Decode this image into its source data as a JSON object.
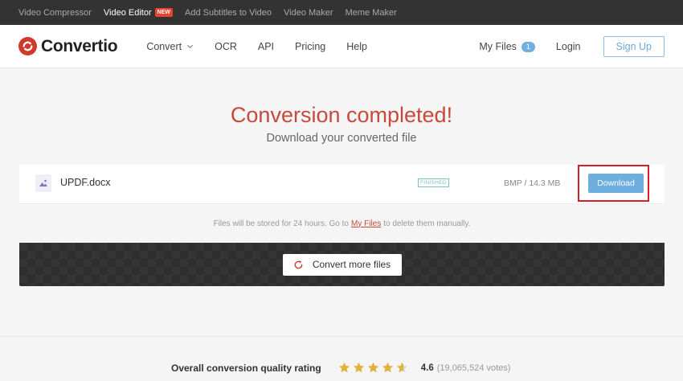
{
  "topbar": {
    "links": [
      {
        "label": "Video Compressor"
      },
      {
        "label": "Video Editor",
        "badge": "NEW"
      },
      {
        "label": "Add Subtitles to Video"
      },
      {
        "label": "Video Maker"
      },
      {
        "label": "Meme Maker"
      }
    ]
  },
  "header": {
    "logo_text": "Convertio",
    "nav": [
      {
        "label": "Convert"
      },
      {
        "label": "OCR"
      },
      {
        "label": "API"
      },
      {
        "label": "Pricing"
      },
      {
        "label": "Help"
      }
    ],
    "my_files_label": "My Files",
    "my_files_count": "1",
    "login_label": "Login",
    "signup_label": "Sign Up"
  },
  "hero": {
    "title": "Conversion completed!",
    "subtitle": "Download your converted file"
  },
  "file": {
    "name": "UPDF.docx",
    "status": "FINISHED",
    "size": "BMP / 14.3 MB",
    "download_label": "Download"
  },
  "note": {
    "before": "Files will be stored for 24 hours. Go to",
    "link": "My Files",
    "after": "to delete them manually."
  },
  "convert_more_label": "Convert more files",
  "rating": {
    "label": "Overall conversion quality rating",
    "score": "4.6",
    "votes": "(19,065,524 votes)",
    "value": 4.6,
    "max": 5
  },
  "colors": {
    "accent_red": "#c8493b",
    "button_blue": "#6eaedf",
    "highlight_red": "#d81e2a",
    "star_gold": "#e2b13c"
  }
}
